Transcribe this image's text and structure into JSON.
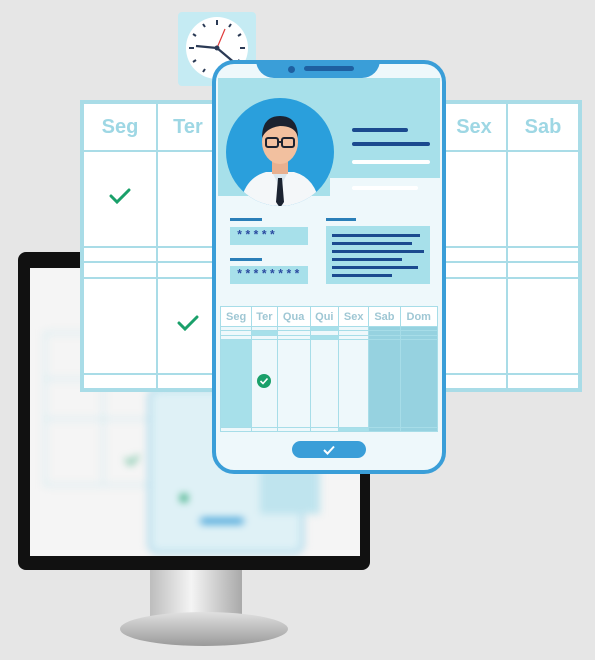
{
  "big_calendar": {
    "headers": [
      "Seg",
      "Ter",
      "",
      "",
      "",
      "Sex",
      "Sab"
    ],
    "checks": [
      [
        1,
        0
      ],
      [
        4,
        1
      ]
    ]
  },
  "phone": {
    "fields": [
      "*****",
      "********"
    ],
    "calendar": {
      "days": [
        "Seg",
        "Ter",
        "Qua",
        "Qui",
        "Sex",
        "Sab",
        "Dom"
      ]
    }
  },
  "colors": {
    "accent": "#3a9ed8",
    "light": "#a7e0ea",
    "check": "#1aa06a"
  },
  "icons": [
    "clock-icon",
    "check-icon",
    "doctor-avatar-icon"
  ]
}
